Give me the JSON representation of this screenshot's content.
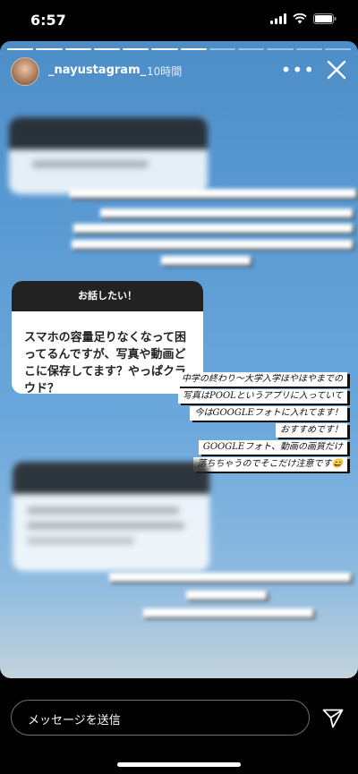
{
  "status_bar": {
    "time": "6:57",
    "icons": [
      "signal-icon",
      "wifi-icon",
      "battery-icon"
    ]
  },
  "story": {
    "username": "_nayustagram_",
    "post_time": "10時間",
    "progress": {
      "segments": 12,
      "current": 7
    },
    "question_card": {
      "header": "お話したい！",
      "question": "スマホの容量足りなくなって困ってるんですが、写真や動画どこに保存してます？やっぱクラウド？",
      "answer_lines": [
        "中学の終わり〜大学入学ほやほやまでの",
        "写真はPOOLというアプリに入っていて",
        "今はGOOGLEフォトに入れてます！",
        "おすすめです！",
        "GOOGLEフォト、動画の画質だけ",
        "落ちちゃうのでそこだけ注意です😄"
      ]
    }
  },
  "message_bar": {
    "placeholder": "メッセージを送信"
  },
  "colors": {
    "sky_top": "#4d8ec8",
    "sky_bottom": "#c2d3dc",
    "card_header": "#222222"
  }
}
